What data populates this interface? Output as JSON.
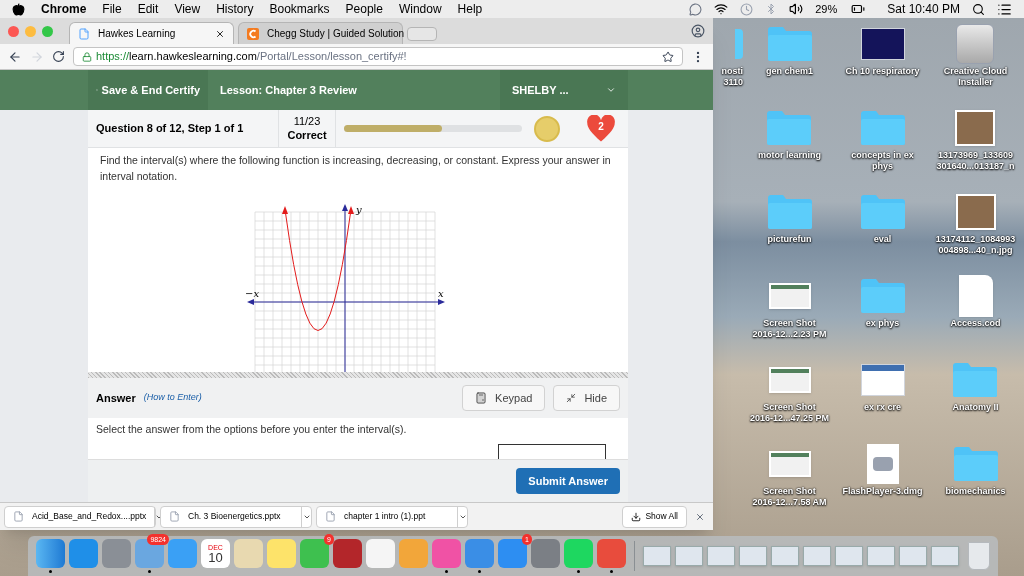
{
  "menubar": {
    "app": "Chrome",
    "menus": [
      "File",
      "Edit",
      "View",
      "History",
      "Bookmarks",
      "People",
      "Window",
      "Help"
    ],
    "battery": "29%",
    "clock": "Sat 10:40 PM"
  },
  "browser": {
    "tabs": [
      {
        "title": "Hawkes Learning",
        "kind": "page",
        "selected": true
      },
      {
        "title": "Chegg Study | Guided Solution",
        "kind": "chegg",
        "selected": false
      }
    ],
    "url": {
      "scheme": "https://",
      "host": "learn.hawkeslearning.com",
      "path": "/Portal/Lesson/lesson_certify#!"
    }
  },
  "lesson_bar": {
    "save_button": "Save & End Certify",
    "lesson": "Lesson: Chapter 3 Review",
    "user": "SHELBY ..."
  },
  "question": {
    "title": "Question 8 of 12, Step 1 of 1",
    "score": "11/23",
    "score_label": "Correct",
    "progress": {
      "level": 0.55
    },
    "lives": "2",
    "prompt": "Find the interval(s) where the following function is increasing, decreasing, or constant. Express your answer in interval notation.",
    "graph": {
      "y_label": "y",
      "x_label": "x",
      "neg_x_label": "−x"
    }
  },
  "answer": {
    "title": "Answer",
    "help_link": "(How to Enter)",
    "keypad": "Keypad",
    "hide": "Hide",
    "instruction": "Select the answer from the options before you enter the interval(s).",
    "submit": "Submit Answer"
  },
  "downloads": {
    "files": [
      "Acid_Base_and_Redox....pptx",
      "Ch. 3 Bioenergetics.pptx",
      "chapter 1 intro (1).ppt"
    ],
    "show_all": "Show All"
  },
  "desktop": {
    "columns": [
      [
        {
          "kind": "folder",
          "lines": [
            "nosti",
            "3110"
          ]
        }
      ],
      [
        {
          "kind": "folder",
          "lines": [
            "gen chem1"
          ]
        },
        {
          "kind": "folder",
          "lines": [
            "motor learning"
          ]
        },
        {
          "kind": "folder",
          "lines": [
            "picturefun"
          ]
        },
        {
          "kind": "screenshot",
          "lines": [
            "Screen Shot",
            "2016-12...2.23 PM"
          ]
        },
        {
          "kind": "screenshot",
          "lines": [
            "Screen Shot",
            "2016-12...47.25 PM"
          ]
        },
        {
          "kind": "screenshot",
          "lines": [
            "Screen Shot",
            "2016-12...7.58 AM"
          ]
        }
      ],
      [
        {
          "kind": "slide",
          "lines": [
            "Ch 10 respiratory"
          ]
        },
        {
          "kind": "folder",
          "lines": [
            "concepts in ex",
            "phys"
          ]
        },
        {
          "kind": "folder",
          "lines": [
            "eval"
          ]
        },
        {
          "kind": "folder",
          "lines": [
            "ex phys"
          ]
        },
        {
          "kind": "document",
          "lines": [
            "ex rx cre"
          ]
        },
        {
          "kind": "disk-image",
          "lines": [
            "FlashPlayer-3.dmg"
          ]
        }
      ],
      [
        {
          "kind": "drive",
          "lines": [
            "Creative Cloud",
            "Installer"
          ]
        },
        {
          "kind": "photo",
          "lines": [
            "13173969_133609",
            "301640...013187_n"
          ]
        },
        {
          "kind": "photo",
          "lines": [
            "13174112_1084993",
            "004898...40_n.jpg"
          ]
        },
        {
          "kind": "blank-file",
          "lines": [
            "Access.cod"
          ]
        },
        {
          "kind": "folder",
          "lines": [
            "Anatomy II"
          ]
        },
        {
          "kind": "folder",
          "lines": [
            "biomechanics"
          ]
        }
      ]
    ]
  },
  "dock": {
    "apps": [
      {
        "kind": "finder",
        "running": true
      },
      {
        "kind": "safari",
        "running": false
      },
      {
        "kind": "rocket",
        "running": false
      },
      {
        "kind": "mail",
        "running": true,
        "badge": "9824"
      },
      {
        "kind": "messages",
        "running": false
      },
      {
        "kind": "calendar",
        "running": false,
        "month": "DEC",
        "day": "10"
      },
      {
        "kind": "preview",
        "running": false
      },
      {
        "kind": "notes",
        "running": false
      },
      {
        "kind": "facetime",
        "running": false,
        "badge": "9"
      },
      {
        "kind": "photobooth",
        "running": false
      },
      {
        "kind": "photos",
        "running": false
      },
      {
        "kind": "pages",
        "running": false
      },
      {
        "kind": "music",
        "running": true
      },
      {
        "kind": "keynote",
        "running": true
      },
      {
        "kind": "appstore",
        "running": false,
        "badge": "1"
      },
      {
        "kind": "settings",
        "running": false
      },
      {
        "kind": "spotify",
        "running": true
      },
      {
        "kind": "chrome",
        "running": true
      }
    ]
  }
}
